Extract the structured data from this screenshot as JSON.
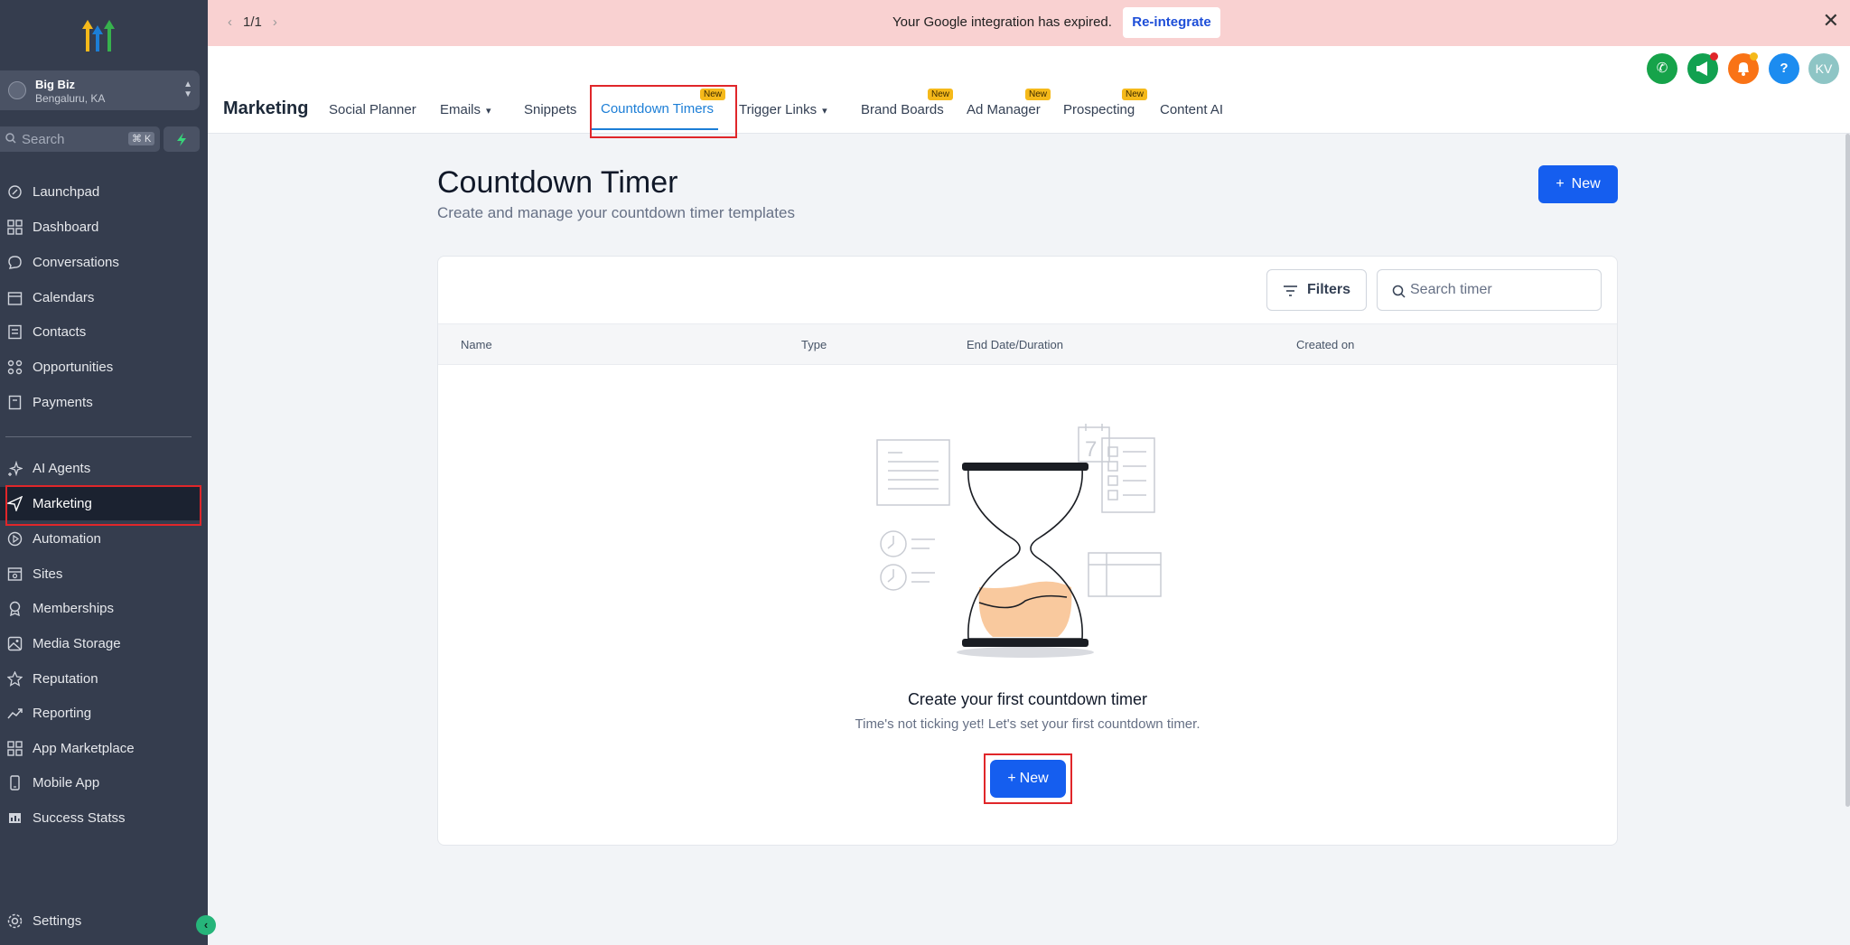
{
  "banner": {
    "pager": "1/1",
    "message": "Your Google integration has expired.",
    "button": "Re-integrate"
  },
  "sidebar": {
    "org_name": "Big Biz",
    "org_location": "Bengaluru, KA",
    "search_placeholder": "Search",
    "search_shortcut": "⌘ K",
    "items": [
      {
        "label": "Launchpad",
        "icon": "rocket-icon"
      },
      {
        "label": "Dashboard",
        "icon": "grid-icon"
      },
      {
        "label": "Conversations",
        "icon": "chat-icon"
      },
      {
        "label": "Calendars",
        "icon": "calendar-icon"
      },
      {
        "label": "Contacts",
        "icon": "contacts-icon"
      },
      {
        "label": "Opportunities",
        "icon": "opportunities-icon"
      },
      {
        "label": "Payments",
        "icon": "payments-icon"
      },
      {
        "label": "AI Agents",
        "icon": "sparkle-icon"
      },
      {
        "label": "Marketing",
        "icon": "send-icon"
      },
      {
        "label": "Automation",
        "icon": "automation-icon"
      },
      {
        "label": "Sites",
        "icon": "sites-icon"
      },
      {
        "label": "Memberships",
        "icon": "membership-icon"
      },
      {
        "label": "Media Storage",
        "icon": "image-icon"
      },
      {
        "label": "Reputation",
        "icon": "star-icon"
      },
      {
        "label": "Reporting",
        "icon": "trend-icon"
      },
      {
        "label": "App Marketplace",
        "icon": "apps-icon"
      },
      {
        "label": "Mobile App",
        "icon": "mobile-icon"
      },
      {
        "label": "Success Statss",
        "icon": "stats-icon"
      }
    ],
    "settings": "Settings"
  },
  "header": {
    "title": "Marketing",
    "badge": "New",
    "tabs": [
      "Social Planner",
      "Emails",
      "Snippets",
      "Countdown Timers",
      "Trigger Links",
      "Brand Boards",
      "Ad Manager",
      "Prospecting",
      "Content AI"
    ],
    "avatar": "KV",
    "help": "?"
  },
  "page": {
    "title": "Countdown Timer",
    "subtitle": "Create and manage your countdown timer templates",
    "new_button": "New",
    "filters": "Filters",
    "search_placeholder": "Search timer",
    "columns": [
      "Name",
      "Type",
      "End Date/Duration",
      "Created on"
    ],
    "empty_title": "Create your first countdown timer",
    "empty_sub": "Time's not ticking yet! Let's set your first countdown timer.",
    "empty_button": "New",
    "calendar_day": "7"
  },
  "colors": {
    "sidebar_bg": "#353d4e",
    "primary": "#155eef",
    "banner_bg": "#f9d1d1",
    "highlight": "#e0262a",
    "badge": "#f5b91a"
  }
}
